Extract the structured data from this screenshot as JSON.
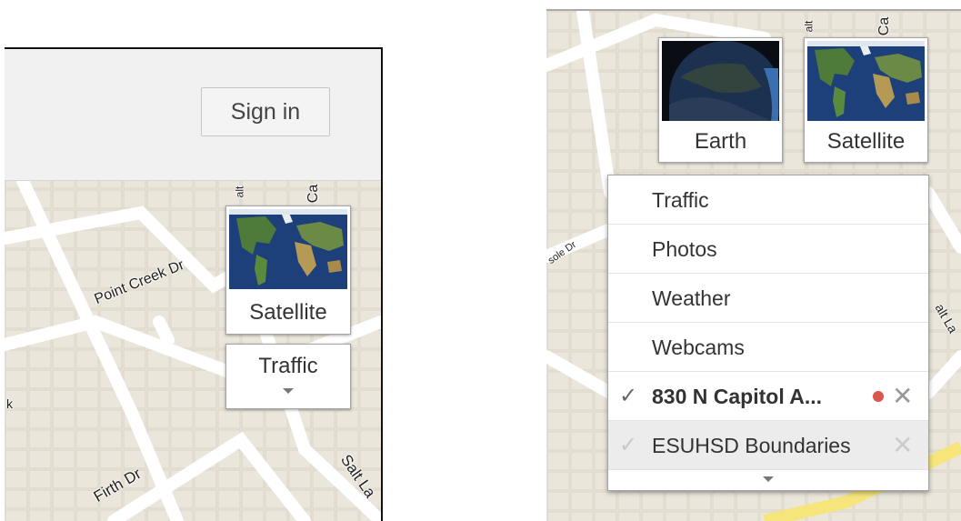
{
  "left_panel": {
    "header": {
      "sign_in_label": "Sign in"
    },
    "streets": {
      "top_right_1": "alt",
      "top_right_2": "Ca",
      "point_creek": "Point Creek Dr",
      "firth": "Firth Dr",
      "salt": "Salt La",
      "partial": "k"
    },
    "satellite_tile": {
      "label": "Satellite"
    },
    "traffic_button": {
      "label": "Traffic"
    }
  },
  "right_panel": {
    "streets": {
      "top_1": "alt",
      "top_2": "Ca",
      "left": "sole Dr",
      "right": "alt La"
    },
    "earth_tile": {
      "label": "Earth"
    },
    "satellite_tile": {
      "label": "Satellite"
    },
    "layers_menu": {
      "items": [
        {
          "label": "Traffic"
        },
        {
          "label": "Photos"
        },
        {
          "label": "Weather"
        },
        {
          "label": "Webcams"
        },
        {
          "label": "830 N Capitol A...",
          "check": "✓",
          "remove": "✕"
        },
        {
          "label": "ESUHSD Boundaries",
          "check": "✓",
          "remove": "✕"
        }
      ]
    }
  },
  "colors": {
    "map_bg": "#ebe6dc",
    "road": "#ffffff",
    "highway": "#f5e57a",
    "pin_dot": "#d9574b"
  }
}
